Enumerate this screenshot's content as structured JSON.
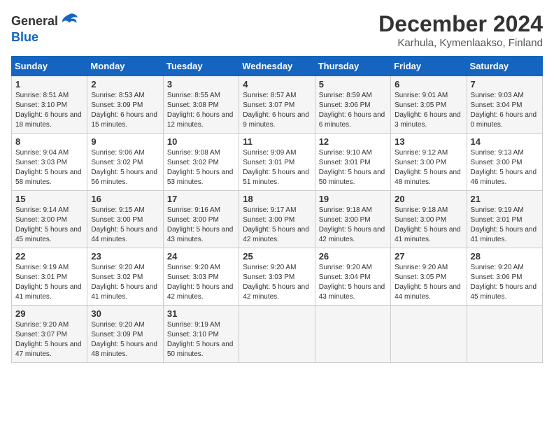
{
  "header": {
    "logo_general": "General",
    "logo_blue": "Blue",
    "month_title": "December 2024",
    "location": "Karhula, Kymenlaakso, Finland"
  },
  "calendar": {
    "days_of_week": [
      "Sunday",
      "Monday",
      "Tuesday",
      "Wednesday",
      "Thursday",
      "Friday",
      "Saturday"
    ],
    "weeks": [
      [
        {
          "day": "1",
          "sunrise": "Sunrise: 8:51 AM",
          "sunset": "Sunset: 3:10 PM",
          "daylight": "Daylight: 6 hours and 18 minutes."
        },
        {
          "day": "2",
          "sunrise": "Sunrise: 8:53 AM",
          "sunset": "Sunset: 3:09 PM",
          "daylight": "Daylight: 6 hours and 15 minutes."
        },
        {
          "day": "3",
          "sunrise": "Sunrise: 8:55 AM",
          "sunset": "Sunset: 3:08 PM",
          "daylight": "Daylight: 6 hours and 12 minutes."
        },
        {
          "day": "4",
          "sunrise": "Sunrise: 8:57 AM",
          "sunset": "Sunset: 3:07 PM",
          "daylight": "Daylight: 6 hours and 9 minutes."
        },
        {
          "day": "5",
          "sunrise": "Sunrise: 8:59 AM",
          "sunset": "Sunset: 3:06 PM",
          "daylight": "Daylight: 6 hours and 6 minutes."
        },
        {
          "day": "6",
          "sunrise": "Sunrise: 9:01 AM",
          "sunset": "Sunset: 3:05 PM",
          "daylight": "Daylight: 6 hours and 3 minutes."
        },
        {
          "day": "7",
          "sunrise": "Sunrise: 9:03 AM",
          "sunset": "Sunset: 3:04 PM",
          "daylight": "Daylight: 6 hours and 0 minutes."
        }
      ],
      [
        {
          "day": "8",
          "sunrise": "Sunrise: 9:04 AM",
          "sunset": "Sunset: 3:03 PM",
          "daylight": "Daylight: 5 hours and 58 minutes."
        },
        {
          "day": "9",
          "sunrise": "Sunrise: 9:06 AM",
          "sunset": "Sunset: 3:02 PM",
          "daylight": "Daylight: 5 hours and 56 minutes."
        },
        {
          "day": "10",
          "sunrise": "Sunrise: 9:08 AM",
          "sunset": "Sunset: 3:02 PM",
          "daylight": "Daylight: 5 hours and 53 minutes."
        },
        {
          "day": "11",
          "sunrise": "Sunrise: 9:09 AM",
          "sunset": "Sunset: 3:01 PM",
          "daylight": "Daylight: 5 hours and 51 minutes."
        },
        {
          "day": "12",
          "sunrise": "Sunrise: 9:10 AM",
          "sunset": "Sunset: 3:01 PM",
          "daylight": "Daylight: 5 hours and 50 minutes."
        },
        {
          "day": "13",
          "sunrise": "Sunrise: 9:12 AM",
          "sunset": "Sunset: 3:00 PM",
          "daylight": "Daylight: 5 hours and 48 minutes."
        },
        {
          "day": "14",
          "sunrise": "Sunrise: 9:13 AM",
          "sunset": "Sunset: 3:00 PM",
          "daylight": "Daylight: 5 hours and 46 minutes."
        }
      ],
      [
        {
          "day": "15",
          "sunrise": "Sunrise: 9:14 AM",
          "sunset": "Sunset: 3:00 PM",
          "daylight": "Daylight: 5 hours and 45 minutes."
        },
        {
          "day": "16",
          "sunrise": "Sunrise: 9:15 AM",
          "sunset": "Sunset: 3:00 PM",
          "daylight": "Daylight: 5 hours and 44 minutes."
        },
        {
          "day": "17",
          "sunrise": "Sunrise: 9:16 AM",
          "sunset": "Sunset: 3:00 PM",
          "daylight": "Daylight: 5 hours and 43 minutes."
        },
        {
          "day": "18",
          "sunrise": "Sunrise: 9:17 AM",
          "sunset": "Sunset: 3:00 PM",
          "daylight": "Daylight: 5 hours and 42 minutes."
        },
        {
          "day": "19",
          "sunrise": "Sunrise: 9:18 AM",
          "sunset": "Sunset: 3:00 PM",
          "daylight": "Daylight: 5 hours and 42 minutes."
        },
        {
          "day": "20",
          "sunrise": "Sunrise: 9:18 AM",
          "sunset": "Sunset: 3:00 PM",
          "daylight": "Daylight: 5 hours and 41 minutes."
        },
        {
          "day": "21",
          "sunrise": "Sunrise: 9:19 AM",
          "sunset": "Sunset: 3:01 PM",
          "daylight": "Daylight: 5 hours and 41 minutes."
        }
      ],
      [
        {
          "day": "22",
          "sunrise": "Sunrise: 9:19 AM",
          "sunset": "Sunset: 3:01 PM",
          "daylight": "Daylight: 5 hours and 41 minutes."
        },
        {
          "day": "23",
          "sunrise": "Sunrise: 9:20 AM",
          "sunset": "Sunset: 3:02 PM",
          "daylight": "Daylight: 5 hours and 41 minutes."
        },
        {
          "day": "24",
          "sunrise": "Sunrise: 9:20 AM",
          "sunset": "Sunset: 3:03 PM",
          "daylight": "Daylight: 5 hours and 42 minutes."
        },
        {
          "day": "25",
          "sunrise": "Sunrise: 9:20 AM",
          "sunset": "Sunset: 3:03 PM",
          "daylight": "Daylight: 5 hours and 42 minutes."
        },
        {
          "day": "26",
          "sunrise": "Sunrise: 9:20 AM",
          "sunset": "Sunset: 3:04 PM",
          "daylight": "Daylight: 5 hours and 43 minutes."
        },
        {
          "day": "27",
          "sunrise": "Sunrise: 9:20 AM",
          "sunset": "Sunset: 3:05 PM",
          "daylight": "Daylight: 5 hours and 44 minutes."
        },
        {
          "day": "28",
          "sunrise": "Sunrise: 9:20 AM",
          "sunset": "Sunset: 3:06 PM",
          "daylight": "Daylight: 5 hours and 45 minutes."
        }
      ],
      [
        {
          "day": "29",
          "sunrise": "Sunrise: 9:20 AM",
          "sunset": "Sunset: 3:07 PM",
          "daylight": "Daylight: 5 hours and 47 minutes."
        },
        {
          "day": "30",
          "sunrise": "Sunrise: 9:20 AM",
          "sunset": "Sunset: 3:09 PM",
          "daylight": "Daylight: 5 hours and 48 minutes."
        },
        {
          "day": "31",
          "sunrise": "Sunrise: 9:19 AM",
          "sunset": "Sunset: 3:10 PM",
          "daylight": "Daylight: 5 hours and 50 minutes."
        },
        {
          "day": "",
          "sunrise": "",
          "sunset": "",
          "daylight": ""
        },
        {
          "day": "",
          "sunrise": "",
          "sunset": "",
          "daylight": ""
        },
        {
          "day": "",
          "sunrise": "",
          "sunset": "",
          "daylight": ""
        },
        {
          "day": "",
          "sunrise": "",
          "sunset": "",
          "daylight": ""
        }
      ]
    ]
  }
}
